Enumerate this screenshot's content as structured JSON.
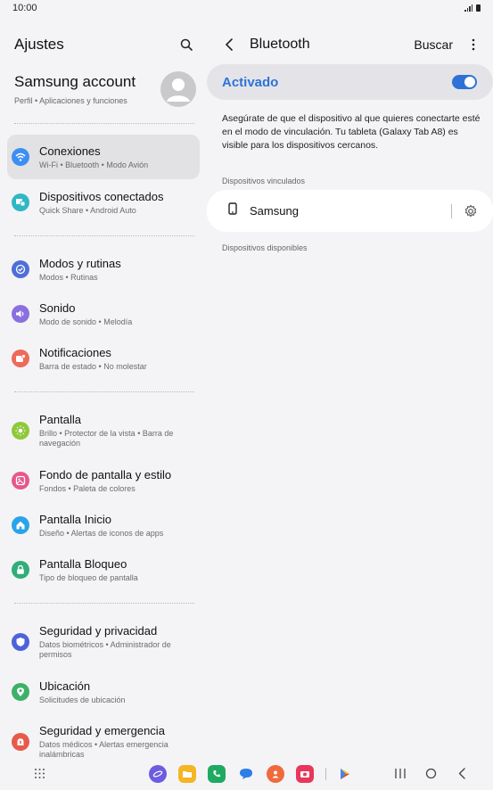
{
  "status_bar": {
    "time": "10:00"
  },
  "left": {
    "title": "Ajustes",
    "account": {
      "name": "Samsung account",
      "subtitle": "Perfil  •  Aplicaciones y funciones"
    },
    "items": [
      {
        "title": "Conexiones",
        "subtitle": "Wi-Fi  •  Bluetooth  •  Modo Avión",
        "color": "#3d8ef2"
      },
      {
        "title": "Dispositivos conectados",
        "subtitle": "Quick Share  •  Android Auto",
        "color": "#2fb8c4"
      },
      {
        "title": "Modos y rutinas",
        "subtitle": "Modos  •  Rutinas",
        "color": "#4f6fd8"
      },
      {
        "title": "Sonido",
        "subtitle": "Modo de sonido  •  Melodía",
        "color": "#8a6fe0"
      },
      {
        "title": "Notificaciones",
        "subtitle": "Barra de estado  •  No molestar",
        "color": "#ee6a5a"
      },
      {
        "title": "Pantalla",
        "subtitle": "Brillo  •  Protector de la vista  •  Barra de navegación",
        "color": "#8fc83a"
      },
      {
        "title": "Fondo de pantalla y estilo",
        "subtitle": "Fondos  •  Paleta de colores",
        "color": "#e8578a"
      },
      {
        "title": "Pantalla Inicio",
        "subtitle": "Diseño  •  Alertas de iconos de apps",
        "color": "#2ba3e8"
      },
      {
        "title": "Pantalla Bloqueo",
        "subtitle": "Tipo de bloqueo de pantalla",
        "color": "#2fae78"
      },
      {
        "title": "Seguridad y privacidad",
        "subtitle": "Datos biométricos  •  Administrador de permisos",
        "color": "#4e63d9"
      },
      {
        "title": "Ubicación",
        "subtitle": "Solicitudes de ubicación",
        "color": "#3fb06a"
      },
      {
        "title": "Seguridad y emergencia",
        "subtitle": "Datos médicos  •  Alertas emergencia inalámbricas",
        "color": "#e65a4c"
      }
    ]
  },
  "right": {
    "title": "Bluetooth",
    "search_label": "Buscar",
    "activated_label": "Activado",
    "toggle_on": true,
    "description": "Asegúrate de que el dispositivo al que quieres conectarte esté en el modo de vinculación. Tu tableta (Galaxy Tab A8) es visible para los dispositivos cercanos.",
    "paired_label": "Dispositivos vinculados",
    "paired_device": "Samsung",
    "available_label": "Dispositivos disponibles"
  },
  "dock_apps": [
    {
      "icon": "internet-icon",
      "color": "#6a5de0"
    },
    {
      "icon": "folder-icon",
      "color": "#f5b524"
    },
    {
      "icon": "phone-icon",
      "color": "#1faa62"
    },
    {
      "icon": "messages-icon",
      "color": "#2f7de6"
    },
    {
      "icon": "contacts-icon",
      "color": "#f06a3c"
    },
    {
      "icon": "camera-icon",
      "color": "#e8375a"
    },
    {
      "icon": "play-store-icon",
      "color": "#ffffff"
    }
  ],
  "colors": {
    "accent": "#2f72d6",
    "background": "#f4f4f6"
  }
}
